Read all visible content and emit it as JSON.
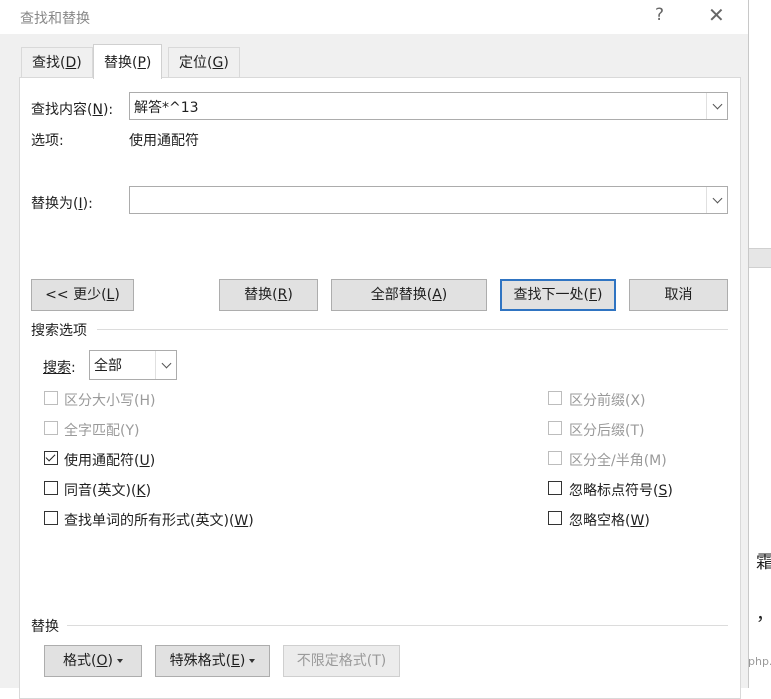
{
  "window": {
    "title": "查找和替换",
    "help": "?",
    "close": "✕"
  },
  "tabs": [
    {
      "label": "查找",
      "key": "D"
    },
    {
      "label": "替换",
      "key": "P"
    },
    {
      "label": "定位",
      "key": "G"
    }
  ],
  "find": {
    "label": "查找内容",
    "key": "N",
    "value": "解答*^13"
  },
  "options": {
    "label": "选项:",
    "value": "使用通配符"
  },
  "replace": {
    "label": "替换为",
    "key": "I",
    "value": ""
  },
  "buttons": {
    "less": {
      "label": "<< 更少",
      "key": "L"
    },
    "replace": {
      "label": "替换",
      "key": "R"
    },
    "replace_all": {
      "label": "全部替换",
      "key": "A"
    },
    "find_next": {
      "label": "查找下一处",
      "key": "F"
    },
    "cancel": "取消"
  },
  "search_options": {
    "title": "搜索选项",
    "search_label": "搜索",
    "search_value": "全部",
    "left": [
      {
        "label": "区分大小写(H)",
        "checked": false,
        "disabled": true
      },
      {
        "label": "全字匹配(Y)",
        "checked": false,
        "disabled": true
      },
      {
        "label": "使用通配符",
        "key": "U",
        "checked": true,
        "disabled": false
      },
      {
        "label": "同音(英文)",
        "key": "K",
        "checked": false,
        "disabled": false
      },
      {
        "label": "查找单词的所有形式(英文)",
        "key": "W",
        "checked": false,
        "disabled": false
      }
    ],
    "right": [
      {
        "label": "区分前缀(X)",
        "checked": false,
        "disabled": true
      },
      {
        "label": "区分后缀(T)",
        "checked": false,
        "disabled": true
      },
      {
        "label": "区分全/半角(M)",
        "checked": false,
        "disabled": true
      },
      {
        "label": "忽略标点符号",
        "key": "S",
        "checked": false,
        "disabled": false
      },
      {
        "label": "忽略空格",
        "key": "W",
        "checked": false,
        "disabled": false
      }
    ]
  },
  "replace_section": {
    "title": "替换",
    "format": {
      "label": "格式",
      "key": "O"
    },
    "special": {
      "label": "特殊格式",
      "key": "E"
    },
    "no_format": "不限定格式(T)"
  },
  "background": {
    "glyph1": "霜",
    "glyph2": "，",
    "watermark": "php.cn"
  }
}
